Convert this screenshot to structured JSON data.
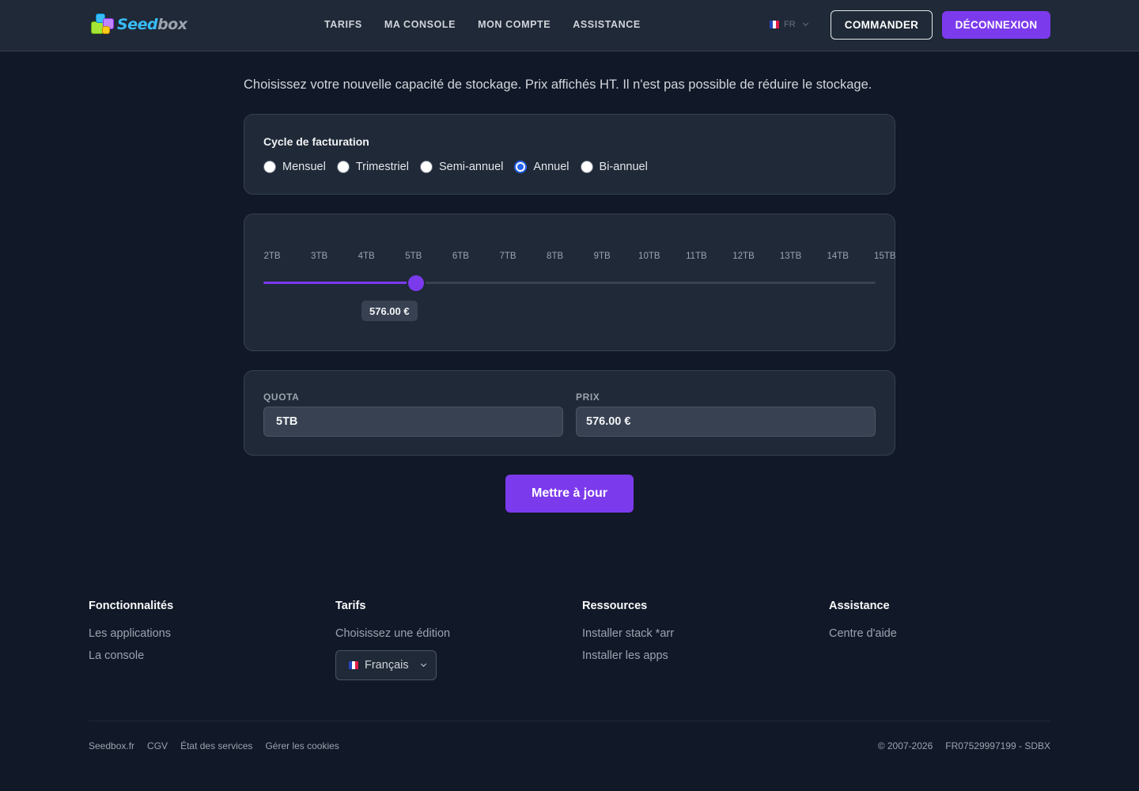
{
  "header": {
    "logo_text_1": "Seed",
    "logo_text_2": "box",
    "nav": [
      "TARIFS",
      "MA CONSOLE",
      "MON COMPTE",
      "ASSISTANCE"
    ],
    "lang_code": "FR",
    "order_button": "COMMANDER",
    "logout_button": "DÉCONNEXION"
  },
  "main": {
    "intro": "Choisissez votre nouvelle capacité de stockage. Prix affichés HT. Il n'est pas possible de réduire le stockage.",
    "billing": {
      "label": "Cycle de facturation",
      "options": [
        "Mensuel",
        "Trimestriel",
        "Semi-annuel",
        "Annuel",
        "Bi-annuel"
      ],
      "selected": "Annuel"
    },
    "slider": {
      "ticks": [
        "2TB",
        "3TB",
        "4TB",
        "5TB",
        "6TB",
        "7TB",
        "8TB",
        "9TB",
        "10TB",
        "11TB",
        "12TB",
        "13TB",
        "14TB",
        "15TB"
      ],
      "selected": "5TB",
      "price_tip": "576.00 €"
    },
    "fields": {
      "quota_label": "QUOTA",
      "quota_value": "5TB",
      "price_label": "PRIX",
      "price_value": "576.00 €"
    },
    "update_button": "Mettre à jour"
  },
  "footer": {
    "columns": [
      {
        "title": "Fonctionnalités",
        "links": [
          "Les applications",
          "La console"
        ]
      },
      {
        "title": "Tarifs",
        "links": [
          "Choisissez une édition"
        ]
      },
      {
        "title": "Ressources",
        "links": [
          "Installer stack *arr",
          "Installer les apps"
        ]
      },
      {
        "title": "Assistance",
        "links": [
          "Centre d'aide"
        ]
      }
    ],
    "language_select": "Français",
    "bottom_links": [
      "Seedbox.fr",
      "CGV",
      "État des services",
      "Gérer les cookies"
    ],
    "copyright": "© 2007-2026",
    "company_id": "FR07529997199 - SDBX"
  },
  "colors": {
    "accent": "#7c3aed",
    "background": "#111827",
    "surface": "#1f2937",
    "radio_selected": "#2563eb"
  }
}
